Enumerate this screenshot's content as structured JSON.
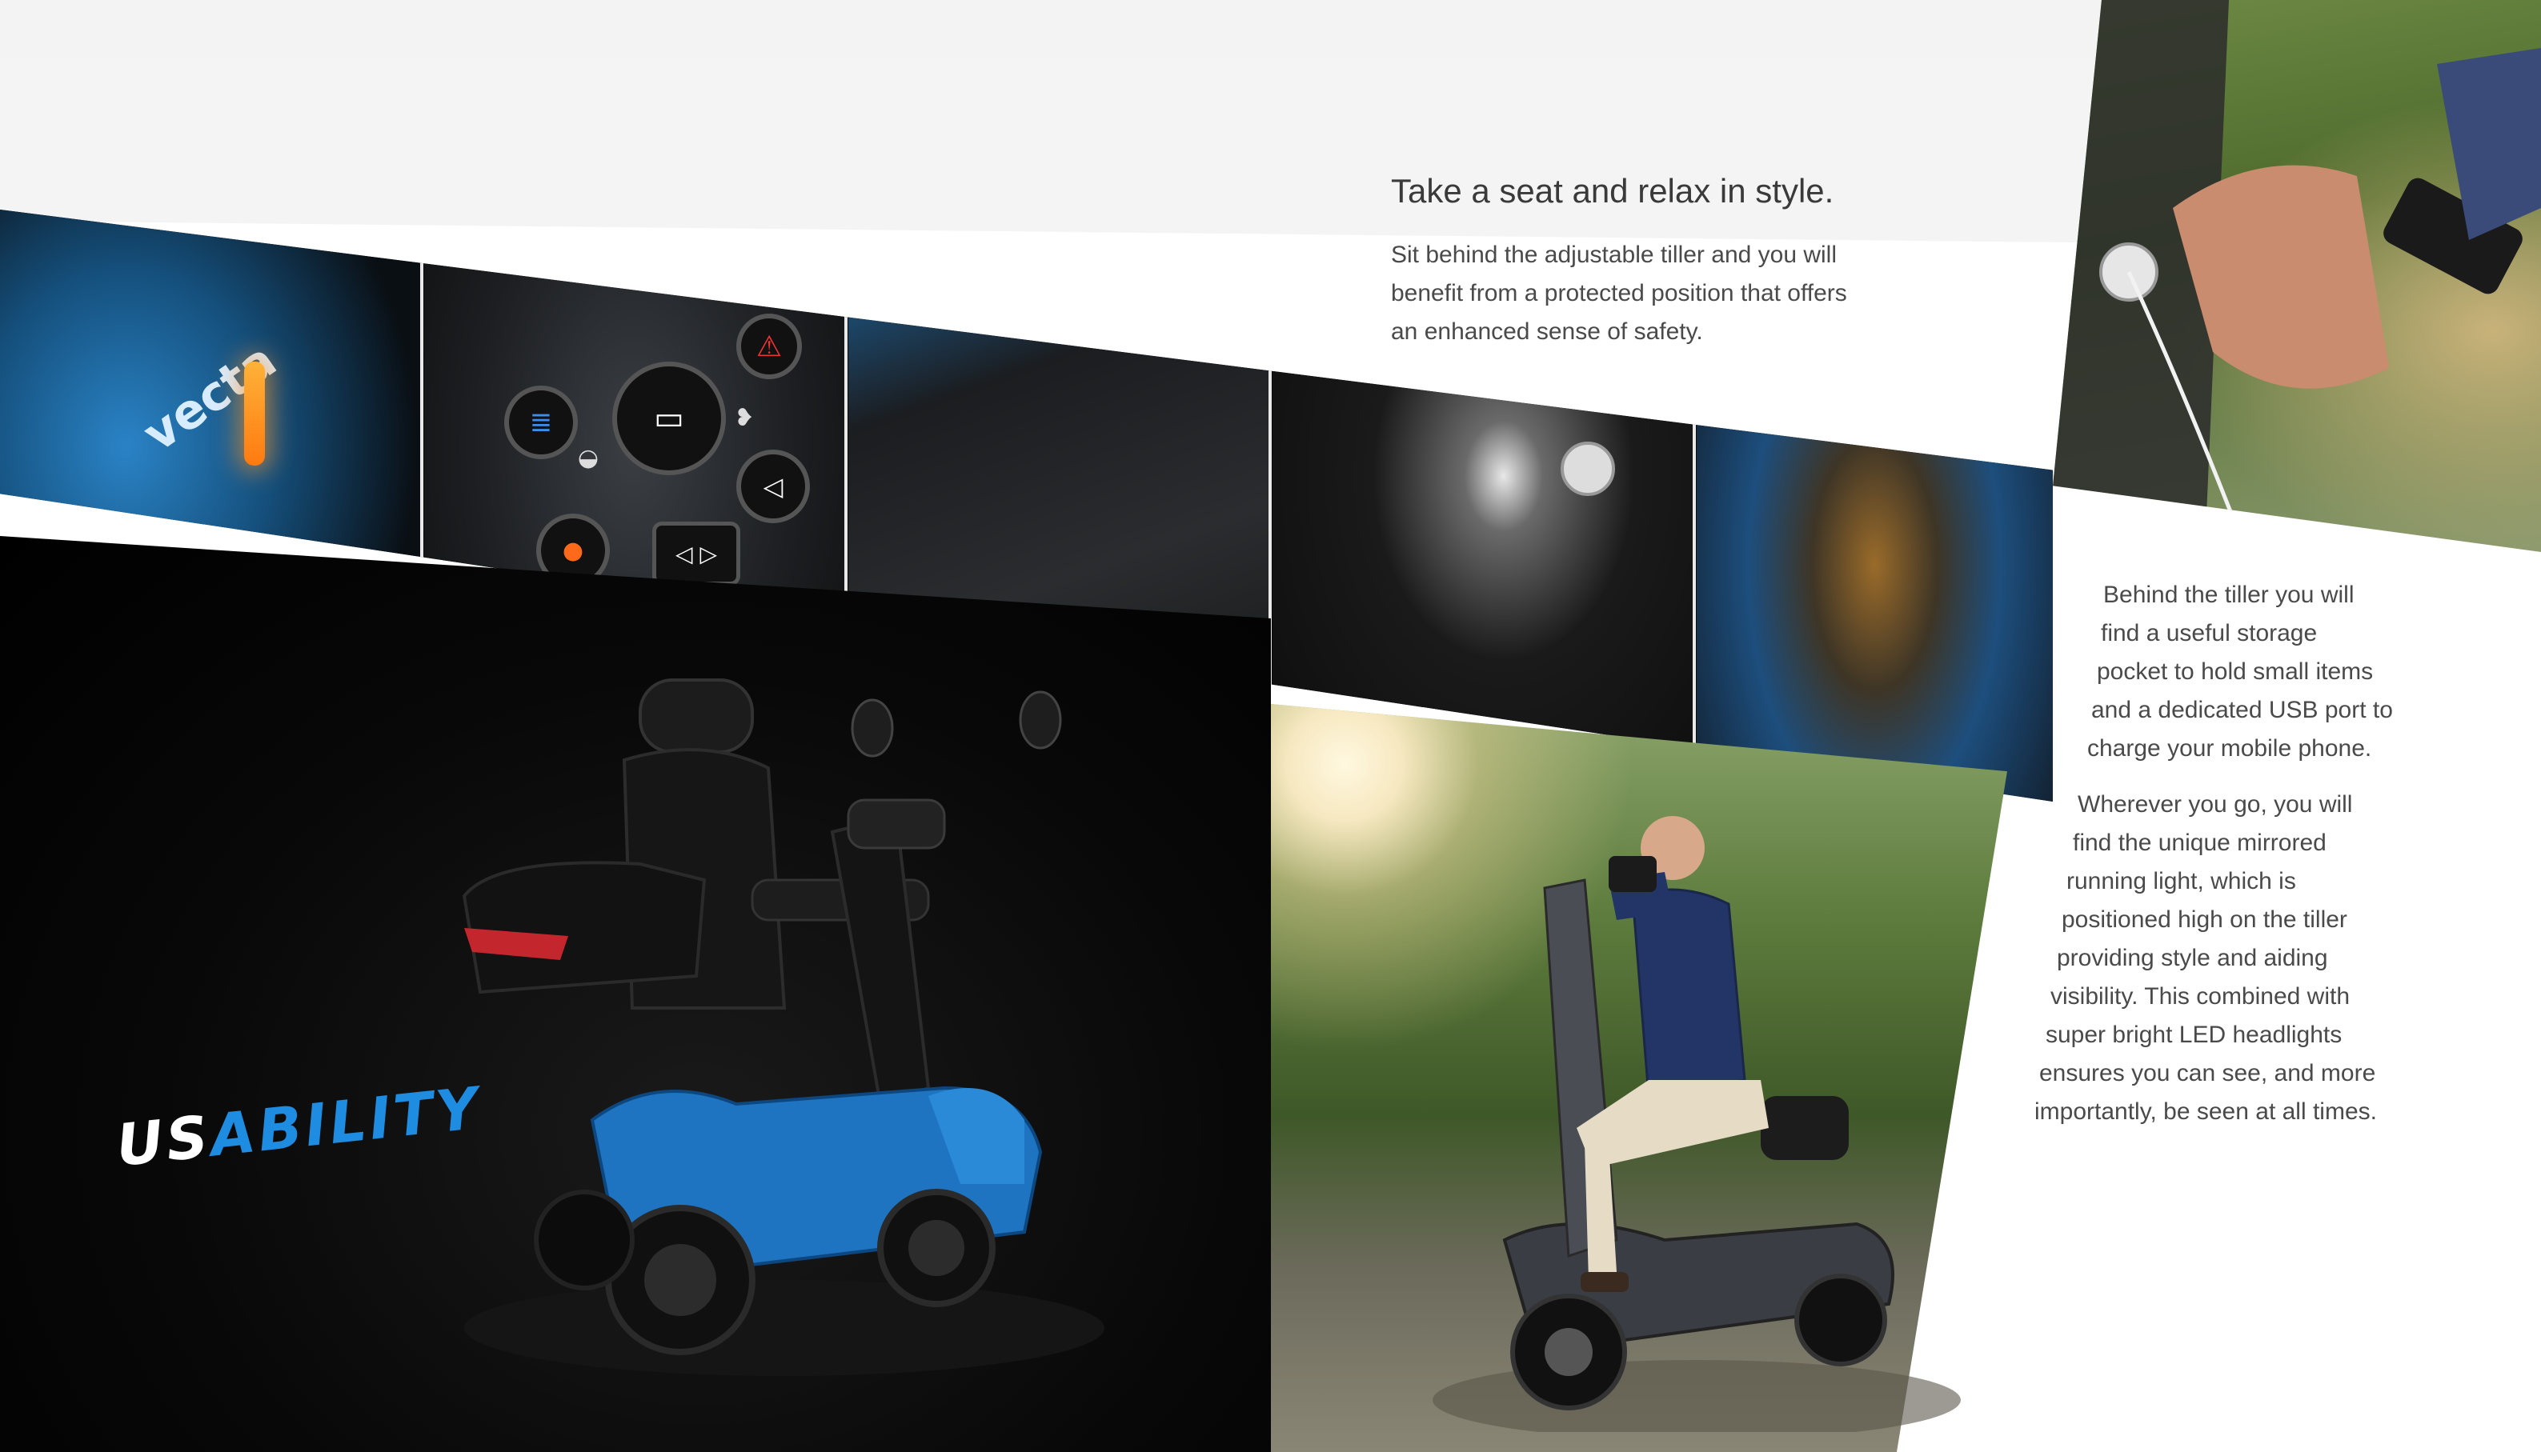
{
  "heading": "Take a seat and relax in style.",
  "intro_lines": [
    "Sit behind the adjustable tiller and you will",
    "benefit from a protected position that offers",
    "an enhanced sense of safety."
  ],
  "storage_lines": [
    "Behind the tiller you will",
    "find a useful storage",
    "pocket to hold small items",
    "and a dedicated USB port to",
    "charge your mobile phone."
  ],
  "light_lines": [
    "Wherever you go, you will",
    "find the unique mirrored",
    "running light, which is",
    "positioned high on the tiller",
    "providing style and aiding",
    "visibility. This combined with",
    "super bright LED headlights",
    "ensures you can see, and more",
    "importantly, be seen at all times."
  ],
  "brand": {
    "vecta": "vecta",
    "section_title_part1": "US",
    "section_title_part2": "ABILITY"
  },
  "colors": {
    "accent_blue": "#1e8ce0",
    "text_gray": "#4a4a4a"
  },
  "icons": [
    "hazard-icon",
    "headlight-icon",
    "battery-gauge-icon",
    "hare-icon",
    "horn-icon",
    "turtle-icon",
    "indicator-arrows-icon",
    "usb-port-icon"
  ]
}
